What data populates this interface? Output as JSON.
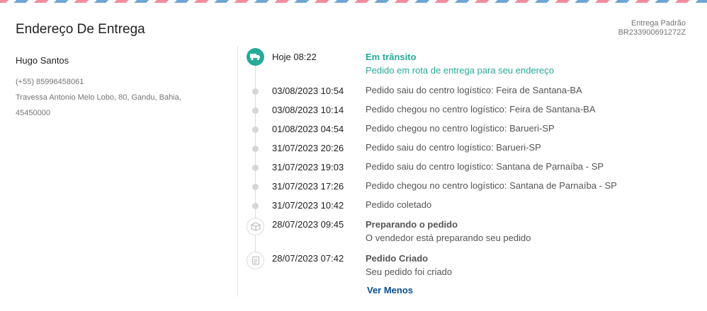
{
  "header": {
    "title": "Endereço De Entrega",
    "shipping_type": "Entrega Padrão",
    "tracking_code": "BR233900691272Z"
  },
  "address": {
    "name": "Hugo Santos",
    "phone": "(+55) 85996458061",
    "street": "Travessa Antonio Melo Lobo, 80, Gandu, Bahia,",
    "zip": "45450000"
  },
  "timeline": {
    "current": {
      "time": "Hoje 08:22",
      "title": "Em trânsito",
      "desc": "Pedido em rota de entrega para seu endereço",
      "icon": "truck-icon"
    },
    "events": [
      {
        "time": "03/08/2023 10:54",
        "desc": "Pedido saiu do centro logístico: Feira de Santana-BA"
      },
      {
        "time": "03/08/2023 10:14",
        "desc": "Pedido chegou no centro logístico: Feira de Santana-BA"
      },
      {
        "time": "01/08/2023 04:54",
        "desc": "Pedido chegou no centro logístico: Barueri-SP"
      },
      {
        "time": "31/07/2023 20:26",
        "desc": "Pedido saiu do centro logístico: Barueri-SP"
      },
      {
        "time": "31/07/2023 19:03",
        "desc": "Pedido saiu do centro logístico: Santana de Parnaíba - SP"
      },
      {
        "time": "31/07/2023 17:26",
        "desc": "Pedido chegou no centro logístico: Santana de Parnaíba - SP"
      },
      {
        "time": "31/07/2023 10:42",
        "desc": "Pedido coletado"
      }
    ],
    "preparing": {
      "time": "28/07/2023 09:45",
      "title": "Preparando o pedido",
      "desc": "O vendedor está preparando seu pedido",
      "icon": "package-icon"
    },
    "created": {
      "time": "28/07/2023 07:42",
      "title": "Pedido Criado",
      "desc": "Seu pedido foi criado",
      "icon": "receipt-icon"
    },
    "toggle_label": "Ver Menos"
  },
  "colors": {
    "accent": "#26aa99",
    "link": "#0a4a94",
    "stripe_blue": "#6fa6d6",
    "stripe_pink": "#f18d9e"
  }
}
